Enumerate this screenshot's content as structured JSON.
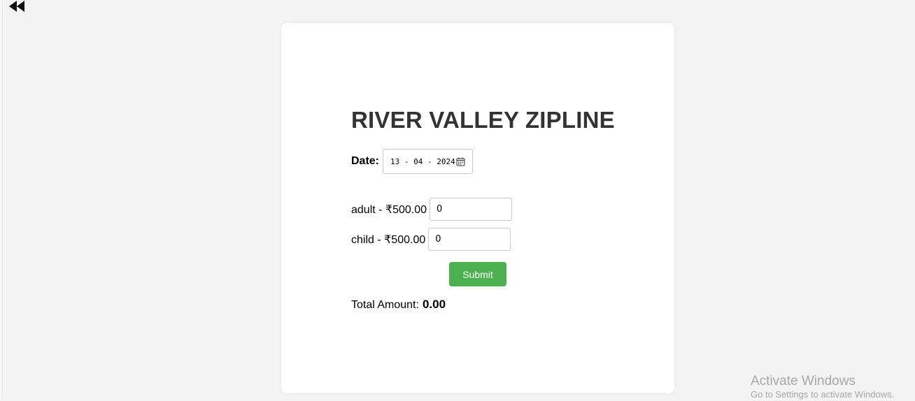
{
  "page": {
    "title": "RIVER VALLEY ZIPLINE",
    "date": {
      "label": "Date:",
      "value": "13 - 04 - 2024"
    },
    "tickets": [
      {
        "label": "adult - ₹500.00",
        "value": "0"
      },
      {
        "label": "child - ₹500.00",
        "value": "0"
      }
    ],
    "submit_label": "Submit",
    "total": {
      "label": "Total Amount:",
      "value": "0.00"
    }
  },
  "icons": {
    "back": "rewind-icon",
    "date": "calendar-icon"
  },
  "colors": {
    "background": "#f3f3f3",
    "card": "#ffffff",
    "title": "#333333",
    "submit": "#4caf50"
  },
  "watermark": {
    "title": "Activate Windows",
    "subtitle": "Go to Settings to activate Windows."
  }
}
